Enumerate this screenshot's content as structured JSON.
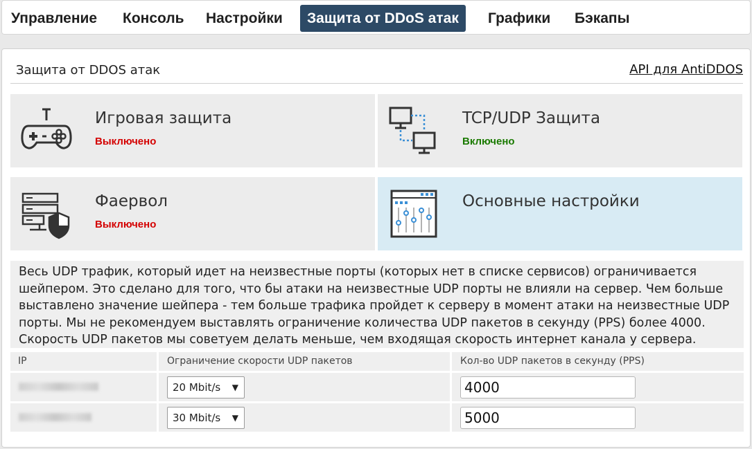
{
  "nav": {
    "tabs": [
      {
        "label": "Управление"
      },
      {
        "label": "Консоль"
      },
      {
        "label": "Настройки"
      },
      {
        "label": "Защита от DDoS атак",
        "active": true
      },
      {
        "label": "Графики"
      },
      {
        "label": "Бэкапы"
      }
    ]
  },
  "panel": {
    "title": "Защита от DDOS атак",
    "api_link": "API для AntiDDOS"
  },
  "tiles": [
    {
      "title": "Игровая защита",
      "status": "Выключено",
      "icon": "gamepad-icon"
    },
    {
      "title": "TCP/UDP Защита",
      "status": "Включено",
      "icon": "network-icon"
    },
    {
      "title": "Фаервол",
      "status": "Выключено",
      "icon": "firewall-icon"
    },
    {
      "title": "Основные настройки",
      "status": "",
      "icon": "settings-sliders-icon"
    }
  ],
  "description": "Весь UDP трафик, который идет на неизвестные порты (которых нет в списке сервисов) ограничивается шейпером. Это сделано для того, что бы атаки на неизвестные UDP порты не влияли на сервер. Чем больше выставлено значение шейпера - тем больше трафика пройдет к серверу в момент атаки на неизвестные UDP порты. Мы не рекомендуем выставлять ограничение количества UDP пакетов в секунду (PPS) более 4000. Скорость UDP пакетов мы советуем делать меньше, чем входящая скорость интернет канала у сервера.",
  "table": {
    "headers": [
      "IP",
      "Ограничение скорости UDP пакетов",
      "Кол-во UDP пакетов в секунду (PPS)"
    ],
    "rows": [
      {
        "speed": "20 Mbit/s",
        "pps": "4000"
      },
      {
        "speed": "30 Mbit/s",
        "pps": "5000"
      }
    ]
  },
  "colors": {
    "active_tab": "#2d4a66",
    "status_off": "#d40000",
    "status_on": "#1a7a00",
    "active_tile": "#d8ebf4"
  }
}
